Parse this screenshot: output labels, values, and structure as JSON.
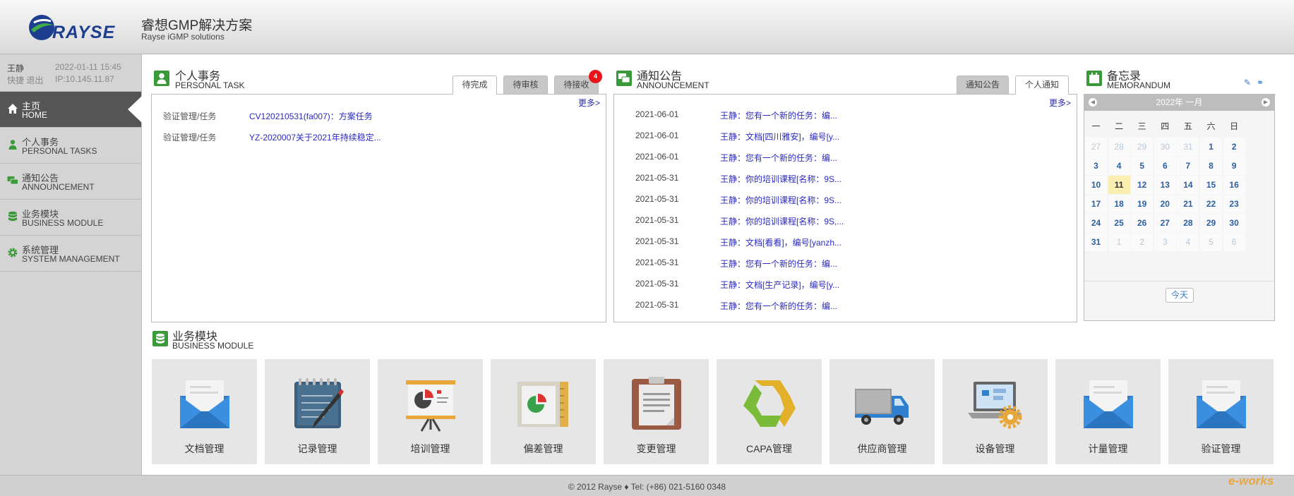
{
  "header": {
    "logo_text": "RAYSE",
    "title": "睿想GMP解决方案",
    "subtitle": "Rayse iGMP solutions",
    "brand_color": "#1d3d8f"
  },
  "user": {
    "name": "王静",
    "datetime": "2022-01-11 15:45",
    "links": "快捷 退出",
    "ip": "IP:10.145.11.87"
  },
  "sidebar": {
    "items": [
      {
        "zh": "主页",
        "en": "HOME",
        "icon": "home-icon",
        "active": true
      },
      {
        "zh": "个人事务",
        "en": "PERSONAL TASKS",
        "icon": "person-icon"
      },
      {
        "zh": "通知公告",
        "en": "ANNOUNCEMENT",
        "icon": "chat-icon"
      },
      {
        "zh": "业务模块",
        "en": "BUSINESS MODULE",
        "icon": "database-icon"
      },
      {
        "zh": "系统管理",
        "en": "SYSTEM MANAGEMENT",
        "icon": "gear-icon"
      }
    ]
  },
  "personal_task": {
    "title": "个人事务",
    "subtitle": "PERSONAL TASK",
    "tabs": [
      {
        "label": "待完成",
        "active": true
      },
      {
        "label": "待审核"
      },
      {
        "label": "待接收",
        "badge": "4"
      }
    ],
    "more": "更多>",
    "rows": [
      {
        "category": "验证管理/任务",
        "text": "CV120210531(fa007)：方案任务"
      },
      {
        "category": "验证管理/任务",
        "text": "YZ-2020007关于2021年持续稳定..."
      }
    ]
  },
  "announcement": {
    "title": "通知公告",
    "subtitle": "ANNOUNCEMENT",
    "tabs": [
      {
        "label": "通知公告"
      },
      {
        "label": "个人通知",
        "active": true
      }
    ],
    "more": "更多>",
    "rows": [
      {
        "date": "2021-06-01",
        "text": "王静：您有一个新的任务：编..."
      },
      {
        "date": "2021-06-01",
        "text": "王静：文档[四川雅安]，编号[y..."
      },
      {
        "date": "2021-06-01",
        "text": "王静：您有一个新的任务：编..."
      },
      {
        "date": "2021-05-31",
        "text": "王静：你的培训课程[名称：9S..."
      },
      {
        "date": "2021-05-31",
        "text": "王静：你的培训课程[名称：9S..."
      },
      {
        "date": "2021-05-31",
        "text": "王静：你的培训课程[名称：9S,..."
      },
      {
        "date": "2021-05-31",
        "text": "王静：文档[看看]，编号[yanzh..."
      },
      {
        "date": "2021-05-31",
        "text": "王静：您有一个新的任务：编..."
      },
      {
        "date": "2021-05-31",
        "text": "王静：文档[生产记录]，编号[y..."
      },
      {
        "date": "2021-05-31",
        "text": "王静：您有一个新的任务：编..."
      }
    ]
  },
  "memo": {
    "title": "备忘录",
    "subtitle": "MEMORANDUM",
    "month_label": "2022年 一月",
    "weekdays": [
      "一",
      "二",
      "三",
      "四",
      "五",
      "六",
      "日"
    ],
    "weeks": [
      [
        "27",
        "28",
        "29",
        "30",
        "31",
        "1",
        "2"
      ],
      [
        "3",
        "4",
        "5",
        "6",
        "7",
        "8",
        "9"
      ],
      [
        "10",
        "11",
        "12",
        "13",
        "14",
        "15",
        "16"
      ],
      [
        "17",
        "18",
        "19",
        "20",
        "21",
        "22",
        "23"
      ],
      [
        "24",
        "25",
        "26",
        "27",
        "28",
        "29",
        "30"
      ],
      [
        "31",
        "1",
        "2",
        "3",
        "4",
        "5",
        "6"
      ]
    ],
    "today": "11",
    "today_button": "今天"
  },
  "business": {
    "title": "业务模块",
    "subtitle": "BUSINESS MODULE",
    "modules": [
      {
        "label": "文档管理",
        "icon": "envelope-icon"
      },
      {
        "label": "记录管理",
        "icon": "notebook-icon"
      },
      {
        "label": "培训管理",
        "icon": "presentation-icon"
      },
      {
        "label": "偏差管理",
        "icon": "chart-document-icon"
      },
      {
        "label": "变更管理",
        "icon": "clipboard-icon"
      },
      {
        "label": "CAPA管理",
        "icon": "recycle-arrows-icon"
      },
      {
        "label": "供应商管理",
        "icon": "truck-icon"
      },
      {
        "label": "设备管理",
        "icon": "laptop-gear-icon"
      },
      {
        "label": "计量管理",
        "icon": "envelope-icon"
      },
      {
        "label": "验证管理",
        "icon": "envelope-icon"
      }
    ]
  },
  "footer": {
    "text": "© 2012 Rayse ♦ Tel: (+86) 021-5160 0348"
  },
  "watermark": "e-works",
  "colors": {
    "accent_green": "#3a9a3a",
    "link_blue": "#2a2ac0",
    "badge_red": "#e8141b",
    "today_highlight": "#fbeeb1"
  }
}
